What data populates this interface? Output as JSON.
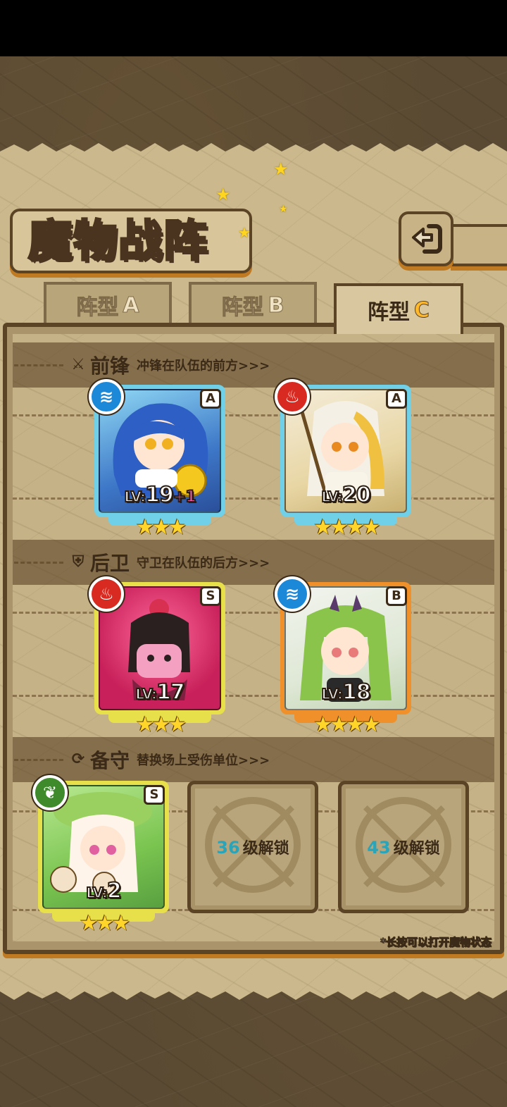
{
  "header": {
    "title": "魔物战阵",
    "back_icon": "back-arrow-icon"
  },
  "tabs": [
    {
      "label": "阵型",
      "suffix": "A",
      "active": false
    },
    {
      "label": "阵型",
      "suffix": "B",
      "active": false
    },
    {
      "label": "阵型",
      "suffix": "C",
      "active": true
    }
  ],
  "sections": {
    "front": {
      "title": "前锋",
      "subtitle": "冲锋在队伍的前方>>>",
      "icon": "sword-icon"
    },
    "back": {
      "title": "后卫",
      "subtitle": "守卫在队伍的后方>>>",
      "icon": "shield-icon"
    },
    "reserve": {
      "title": "备守",
      "subtitle": "替换场上受伤单位>>>",
      "icon": "refresh-icon"
    }
  },
  "monsters": {
    "front_1": {
      "rank": "A",
      "element": "water",
      "level_label": "LV:",
      "level": "19",
      "bonus": "+1",
      "stars": "★★★",
      "frame_color": "#6fd0e8"
    },
    "front_2": {
      "rank": "A",
      "element": "fire",
      "level_label": "LV:",
      "level": "20",
      "stars": "★★★★",
      "frame_color": "#6fd0e8"
    },
    "back_1": {
      "rank": "S",
      "element": "fire",
      "level_label": "LV:",
      "level": "17",
      "stars": "★★★",
      "frame_color": "#e8e04a"
    },
    "back_2": {
      "rank": "B",
      "element": "water",
      "level_label": "LV:",
      "level": "18",
      "stars": "★★★★",
      "frame_color": "#f0902a"
    },
    "reserve_1": {
      "rank": "S",
      "element": "nature",
      "level_label": "LV:",
      "level": "2",
      "stars": "★★★",
      "frame_color": "#e8e04a"
    }
  },
  "locked_slots": [
    {
      "level": "36",
      "text": "级解锁"
    },
    {
      "level": "43",
      "text": "级解锁"
    }
  ],
  "hint": "*长按可以打开魔物状态",
  "colors": {
    "water": "#1c88d8",
    "fire": "#d82a20",
    "nature": "#3f8a2a"
  }
}
